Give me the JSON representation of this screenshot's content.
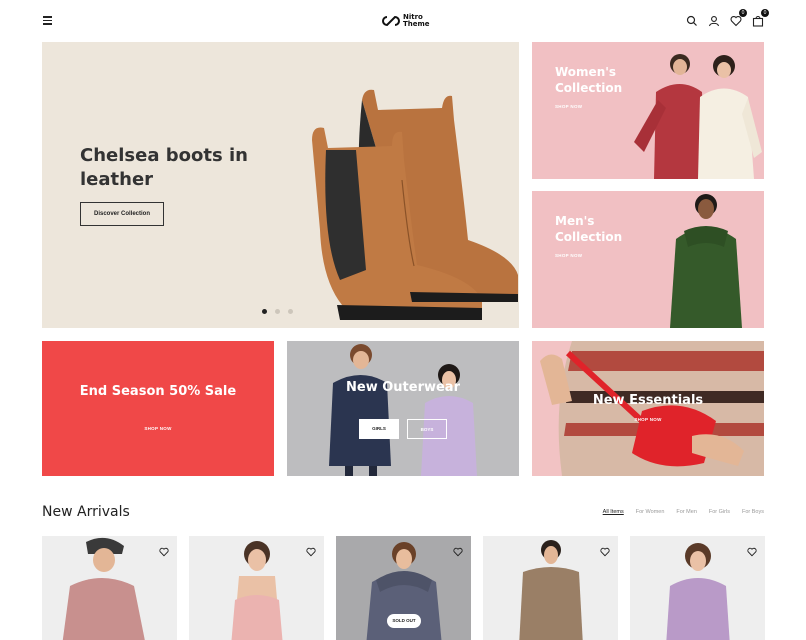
{
  "header": {
    "logo_line1": "Nitro",
    "logo_line2": "Theme",
    "wishlist_count": "0",
    "cart_count": "0",
    "icons": [
      "menu-icon",
      "search-icon",
      "user-icon",
      "heart-icon",
      "bag-icon"
    ]
  },
  "hero": {
    "title": "Chelsea boots in leather",
    "button_label": "Discover Collection",
    "slides": 3,
    "active_slide": 1,
    "bg_color": "#ede6db"
  },
  "side_banners": [
    {
      "title": "Women's Collection",
      "link": "SHOP NOW"
    },
    {
      "title": "Men's Collection",
      "link": "SHOP NOW"
    }
  ],
  "tiles": {
    "sale": {
      "title": "End Season 50% Sale",
      "link": "SHOP NOW",
      "bg_color": "#f04848"
    },
    "outerwear": {
      "title": "New Outerwear",
      "buttons": [
        "GIRLS",
        "BOYS"
      ]
    },
    "essentials": {
      "title": "New Essentials",
      "link": "SHOP NOW"
    }
  },
  "new_arrivals": {
    "title": "New Arrivals",
    "filters": [
      "All Items",
      "For Women",
      "For Men",
      "For Girls",
      "For Boys"
    ],
    "active_filter": "All Items",
    "sold_out_label": "SOLD OUT"
  },
  "colors": {
    "accent": "#f04848",
    "pink": "#f1c0c3",
    "dark": "#222222"
  }
}
